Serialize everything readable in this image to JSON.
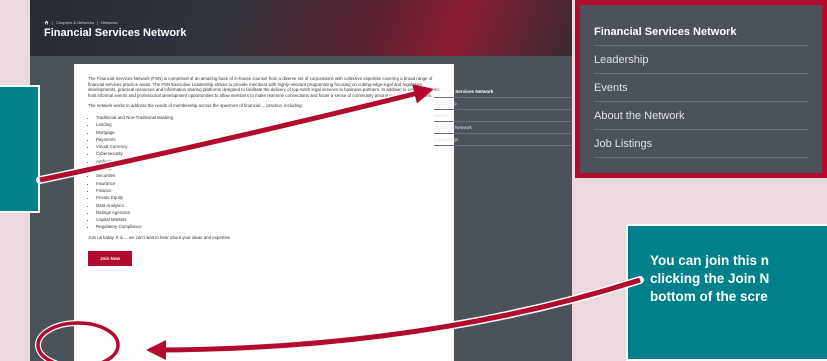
{
  "header": {
    "breadcrumb": [
      "Chapters & Networks",
      "Networks"
    ],
    "breadcrumb_sep": "|",
    "title": "Financial Services Network"
  },
  "content": {
    "paragraph1": "The Financial Services Network (FSN) is comprised of an amazing base of in-house counsel from a diverse set of corporations with collective expertise covering a broad range of financial services practice areas. The FSN Executive Leadership strives to provide members with highly-relevant programming focusing on cutting-edge legal and regulatory developments, practical resources and information sharing platforms designed to facilitate the delivery of top-notch legal services to business partners. In addition to content, we also host informal events and professional development opportunities to allow members to make real-time connections and foster a sense of community among in-house practitioners.",
    "paragraph2": "The network works to address the needs of membership across the spectrum of financial ... practice, including:",
    "list": [
      "Traditional and Non-Traditional Banking",
      "Lending",
      "Mortgage",
      "Payments",
      "Virtual Currency",
      "Cybersecurity",
      "Artificial Intelligence",
      "FinTech",
      "Securities",
      "Insurance",
      "Finance",
      "Private Equity",
      "Data Analytics",
      "Ratings Agencies",
      "Capital Markets",
      "Regulatory Compliance"
    ],
    "closing": "Join us today. It is ... we can't wait to hear about your ideas and expertise.",
    "join_label": "Join Now"
  },
  "side_nav": [
    "Financial Services Network",
    "Leadership",
    "Events",
    "About the Network",
    "Job Listings"
  ],
  "callout_right": "You can join this n\nclicking the Join N\nbottom of the scre",
  "colors": {
    "accent": "#b30a2f",
    "teal": "#00808a",
    "panel": "#4b525a"
  }
}
